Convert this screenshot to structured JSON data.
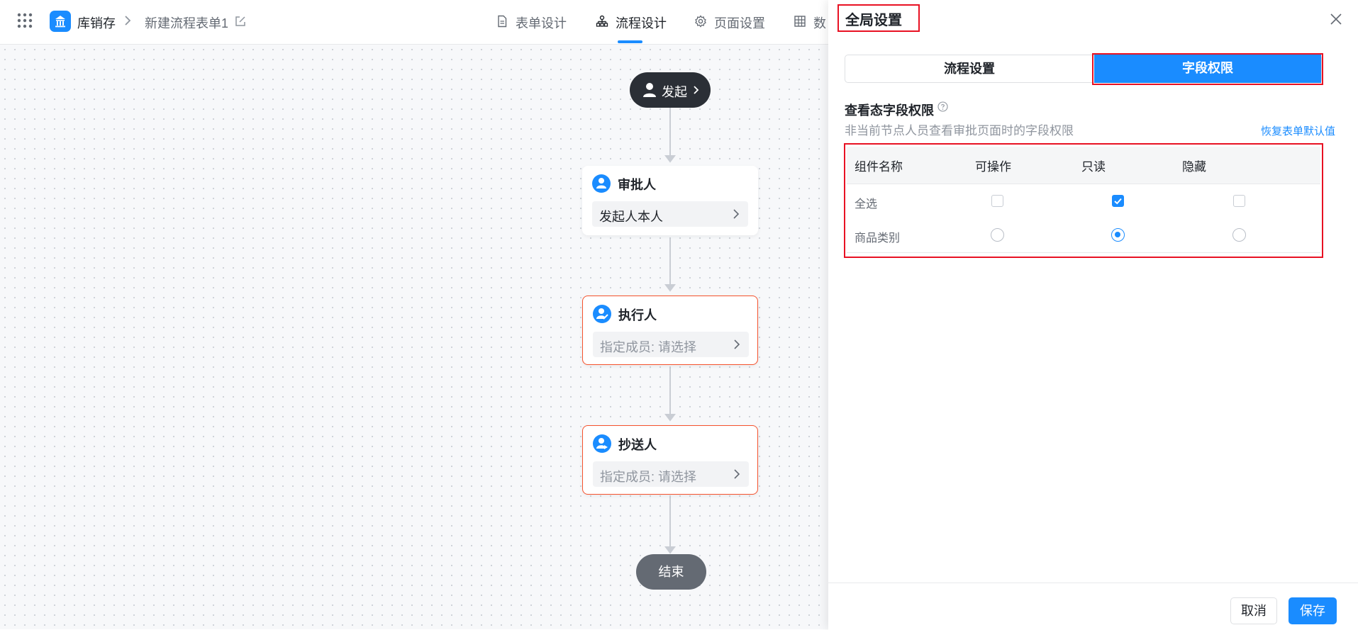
{
  "header": {
    "app_name": "库销存",
    "form_name": "新建流程表单1",
    "tabs": [
      {
        "label": "表单设计",
        "icon": "document-icon"
      },
      {
        "label": "流程设计",
        "icon": "flow-icon",
        "active": true
      },
      {
        "label": "页面设置",
        "icon": "gear-icon"
      },
      {
        "label": "数",
        "icon": "table-icon"
      }
    ]
  },
  "flow": {
    "start_label": "发起",
    "nodes": [
      {
        "title": "审批人",
        "body": "发起人本人",
        "placeholder": false
      },
      {
        "title": "执行人",
        "body": "指定成员: 请选择",
        "placeholder": true
      },
      {
        "title": "抄送人",
        "body": "指定成员: 请选择",
        "placeholder": true
      }
    ],
    "end_label": "结束"
  },
  "drawer": {
    "title": "全局设置",
    "segments": [
      "流程设置",
      "字段权限"
    ],
    "active_segment": "字段权限",
    "section_title": "查看态字段权限",
    "section_desc": "非当前节点人员查看审批页面时的字段权限",
    "restore_link": "恢复表单默认值",
    "table": {
      "headers": [
        "组件名称",
        "可操作",
        "只读",
        "隐藏"
      ],
      "rows": [
        {
          "name": "全选",
          "control": "checkbox",
          "selected": "只读"
        },
        {
          "name": "商品类别",
          "control": "radio",
          "selected": "只读"
        }
      ]
    },
    "cancel_label": "取消",
    "save_label": "保存"
  },
  "colors": {
    "accent": "#1a8cff",
    "warning_border": "#f5522d",
    "annotation_red": "#e81123"
  }
}
